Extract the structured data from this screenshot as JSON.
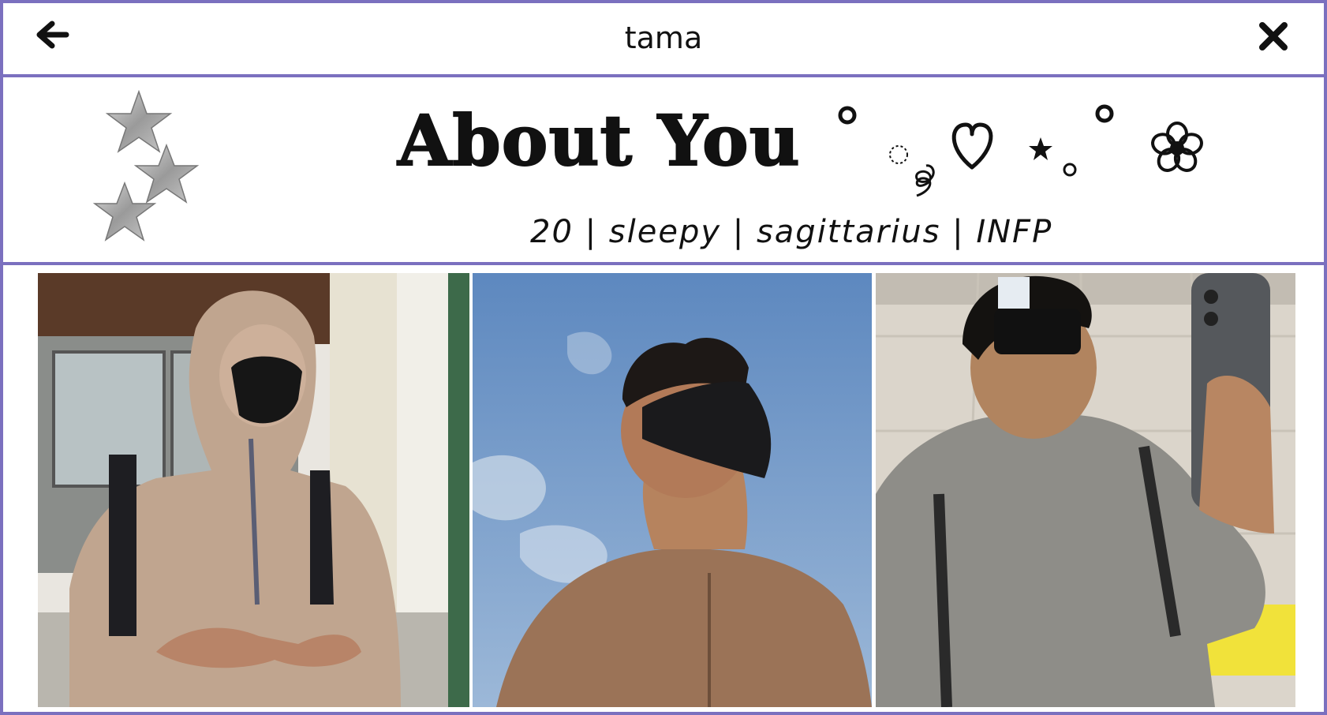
{
  "window": {
    "title": "tama",
    "back_icon": "arrow-left-icon",
    "close_icon": "close-x-icon"
  },
  "header": {
    "heading": "About You",
    "tagline": "20 | sleepy | sagittarius | INFP",
    "decor_icons": [
      "star-patches",
      "ring-doodle",
      "dotted-circle-doodle",
      "swirl-doodle",
      "heart-icon",
      "star-icon",
      "flower-icon"
    ]
  },
  "gallery": {
    "photos": [
      {
        "name": "photo-hooded-mask",
        "description_icon": "person-photo"
      },
      {
        "name": "photo-sky-selfie",
        "description_icon": "person-photo"
      },
      {
        "name": "photo-mirror-selfie",
        "description_icon": "person-photo"
      }
    ]
  },
  "colors": {
    "border": "#7b70bf",
    "text": "#111111",
    "background": "#ffffff"
  }
}
